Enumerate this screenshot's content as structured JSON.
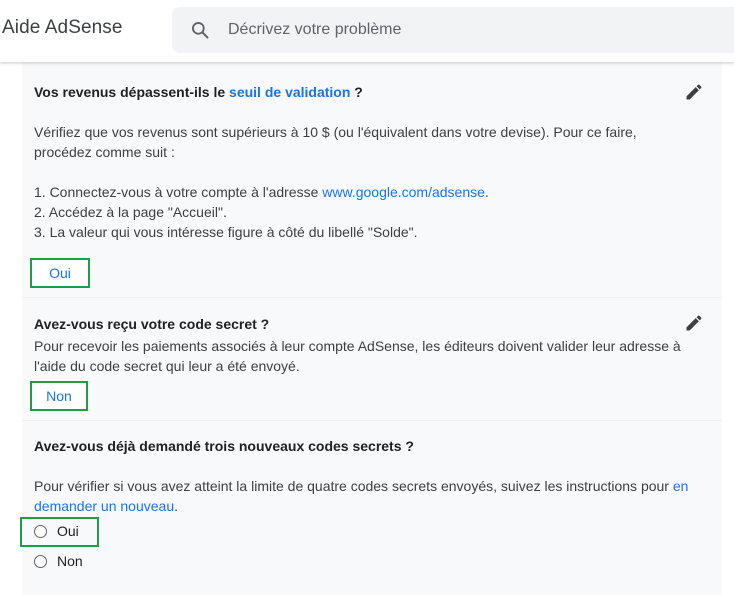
{
  "header": {
    "app_title": "Aide AdSense",
    "search_placeholder": "Décrivez votre problème",
    "search_value": ""
  },
  "steps": [
    {
      "question_prefix": "Vos revenus dépassent-ils le ",
      "question_link": "seuil de validation",
      "question_suffix": " ?",
      "intro": "Vérifiez que vos revenus sont supérieurs à 10 $ (ou l'équivalent dans votre devise). Pour ce faire, procédez comme suit :",
      "list_1_prefix": "1. Connectez-vous à votre compte à l'adresse ",
      "list_1_link": "www.google.com/adsense",
      "list_1_suffix": ".",
      "list_2": "2. Accédez à la page \"Accueil\".",
      "list_3": "3. La valeur qui vous intéresse figure à côté du libellé \"Solde\".",
      "answer": "Oui"
    },
    {
      "question": "Avez-vous reçu votre code secret ?",
      "body": "Pour recevoir les paiements associés à leur compte AdSense, les éditeurs doivent valider leur adresse à l'aide du code secret qui leur a été envoyé.",
      "answer": "Non"
    },
    {
      "question": "Avez-vous déjà demandé trois nouveaux codes secrets ?",
      "body": "Pour vérifier si vous avez atteint la limite de quatre codes secrets envoyés, suivez les instructions pour ",
      "body_link": "en demander un nouveau",
      "body_suffix": ".",
      "options": [
        "Oui",
        "Non"
      ]
    }
  ],
  "colors": {
    "link": "#1a73e8",
    "highlight": "#1e9e46",
    "panel": "#f8f9fa"
  }
}
